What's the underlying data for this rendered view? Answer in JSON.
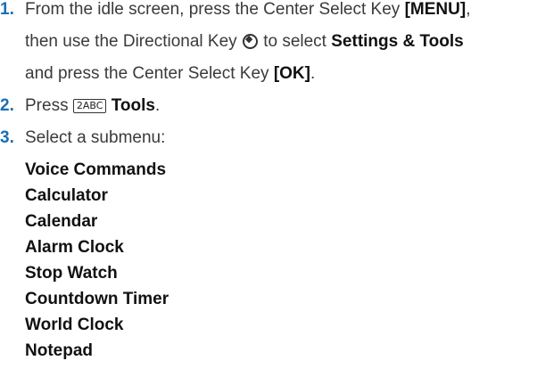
{
  "steps": [
    {
      "number": "1.",
      "lines": [
        {
          "t1": "From the idle screen, press the Center Select Key ",
          "b1": "[MENU]",
          "t2": ","
        },
        {
          "t1": "then use the Directional Key ",
          "icon": "directional-key-icon",
          "t2": " to select ",
          "b1": "Settings & Tools"
        },
        {
          "t1": "and press the Center Select Key ",
          "b1": "[OK]",
          "t2": "."
        }
      ]
    },
    {
      "number": "2.",
      "text": "Press ",
      "key_label": "2ABC",
      "bold": "Tools",
      "end": "."
    },
    {
      "number": "3.",
      "text": "Select a submenu:"
    }
  ],
  "submenus": [
    "Voice Commands",
    "Calculator",
    "Calendar",
    "Alarm Clock",
    "Stop Watch",
    "Countdown Timer",
    "World Clock",
    "Notepad"
  ]
}
